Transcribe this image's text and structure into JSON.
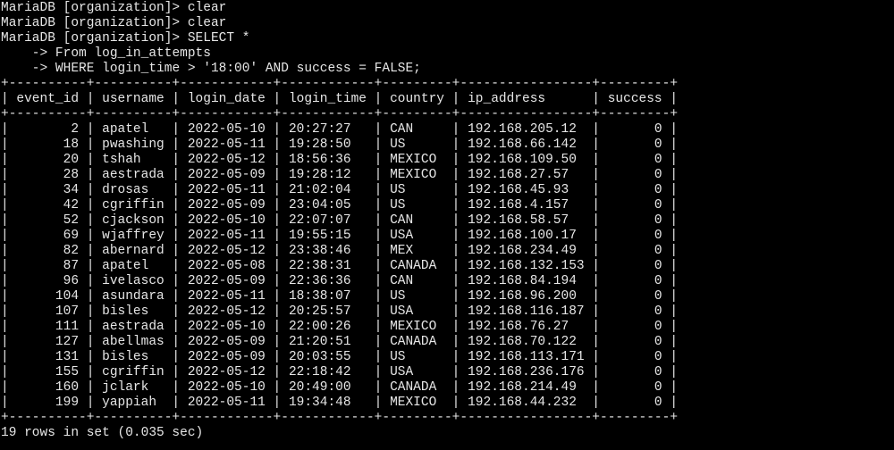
{
  "terminal": {
    "prompt": "MariaDB [organization]> ",
    "continuation_prompt": "    -> ",
    "history": [
      {
        "prompt": "MariaDB [organization]> ",
        "command": "clear"
      },
      {
        "prompt": "MariaDB [organization]> ",
        "command": "clear"
      },
      {
        "prompt": "MariaDB [organization]> ",
        "command": "SELECT *"
      },
      {
        "prompt": "    -> ",
        "command": "From log_in_attempts"
      },
      {
        "prompt": "    -> ",
        "command": "WHERE login_time > '18:00' AND success = FALSE;"
      }
    ],
    "colors": {
      "background": "#000000",
      "foreground": "#e6e6e6"
    }
  },
  "result": {
    "columns": [
      "event_id",
      "username",
      "login_date",
      "login_time",
      "country",
      "ip_address",
      "success"
    ],
    "rows": [
      [
        "2",
        "apatel",
        "2022-05-10",
        "20:27:27",
        "CAN",
        "192.168.205.12",
        "0"
      ],
      [
        "18",
        "pwashing",
        "2022-05-11",
        "19:28:50",
        "US",
        "192.168.66.142",
        "0"
      ],
      [
        "20",
        "tshah",
        "2022-05-12",
        "18:56:36",
        "MEXICO",
        "192.168.109.50",
        "0"
      ],
      [
        "28",
        "aestrada",
        "2022-05-09",
        "19:28:12",
        "MEXICO",
        "192.168.27.57",
        "0"
      ],
      [
        "34",
        "drosas",
        "2022-05-11",
        "21:02:04",
        "US",
        "192.168.45.93",
        "0"
      ],
      [
        "42",
        "cgriffin",
        "2022-05-09",
        "23:04:05",
        "US",
        "192.168.4.157",
        "0"
      ],
      [
        "52",
        "cjackson",
        "2022-05-10",
        "22:07:07",
        "CAN",
        "192.168.58.57",
        "0"
      ],
      [
        "69",
        "wjaffrey",
        "2022-05-11",
        "19:55:15",
        "USA",
        "192.168.100.17",
        "0"
      ],
      [
        "82",
        "abernard",
        "2022-05-12",
        "23:38:46",
        "MEX",
        "192.168.234.49",
        "0"
      ],
      [
        "87",
        "apatel",
        "2022-05-08",
        "22:38:31",
        "CANADA",
        "192.168.132.153",
        "0"
      ],
      [
        "96",
        "ivelasco",
        "2022-05-09",
        "22:36:36",
        "CAN",
        "192.168.84.194",
        "0"
      ],
      [
        "104",
        "asundara",
        "2022-05-11",
        "18:38:07",
        "US",
        "192.168.96.200",
        "0"
      ],
      [
        "107",
        "bisles",
        "2022-05-12",
        "20:25:57",
        "USA",
        "192.168.116.187",
        "0"
      ],
      [
        "111",
        "aestrada",
        "2022-05-10",
        "22:00:26",
        "MEXICO",
        "192.168.76.27",
        "0"
      ],
      [
        "127",
        "abellmas",
        "2022-05-09",
        "21:20:51",
        "CANADA",
        "192.168.70.122",
        "0"
      ],
      [
        "131",
        "bisles",
        "2022-05-09",
        "20:03:55",
        "US",
        "192.168.113.171",
        "0"
      ],
      [
        "155",
        "cgriffin",
        "2022-05-12",
        "22:18:42",
        "USA",
        "192.168.236.176",
        "0"
      ],
      [
        "160",
        "jclark",
        "2022-05-10",
        "20:49:00",
        "CANADA",
        "192.168.214.49",
        "0"
      ],
      [
        "199",
        "yappiah",
        "2022-05-11",
        "19:34:48",
        "MEXICO",
        "192.168.44.232",
        "0"
      ]
    ],
    "summary": "19 rows in set (0.035 sec)"
  }
}
